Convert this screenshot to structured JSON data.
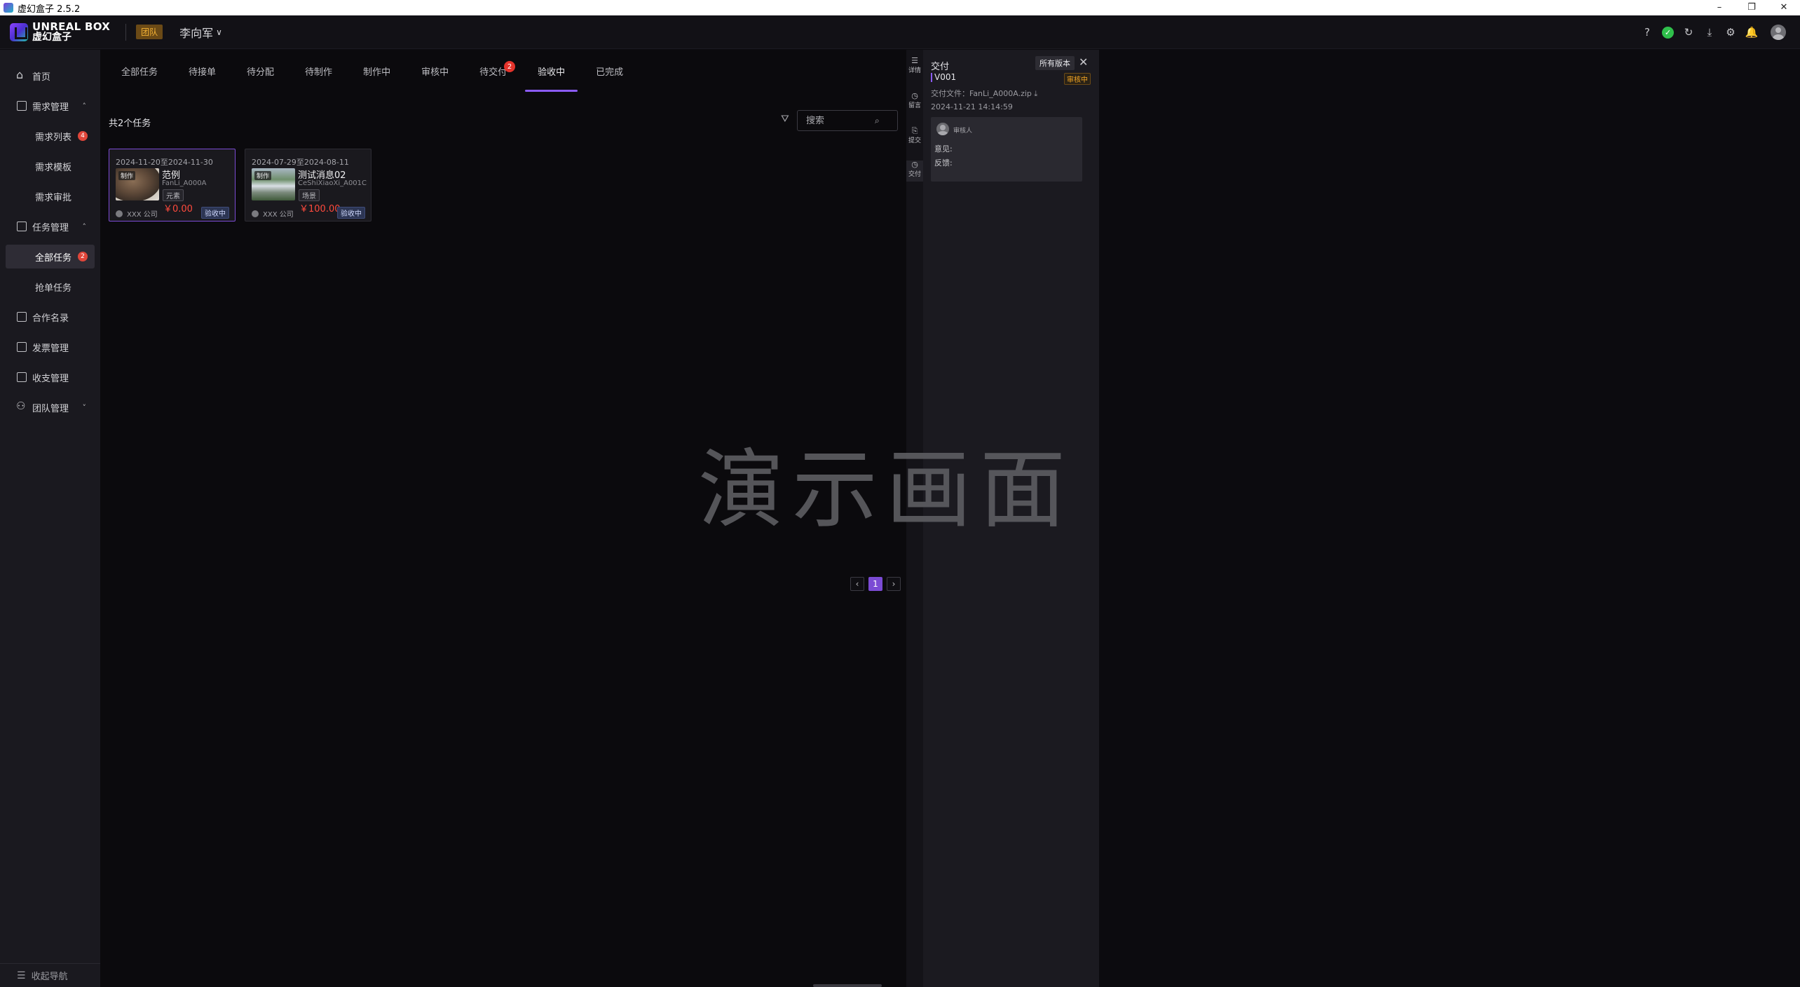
{
  "window": {
    "title": "虚幻盒子 2.5.2",
    "controls": [
      "–",
      "❐",
      "✕"
    ]
  },
  "header": {
    "logo_en": "UNREAL BOX",
    "logo_cn": "虚幻盒子",
    "team_badge": "团队",
    "user_name": "李向军",
    "user_chevron": "∨",
    "icons": [
      "help-icon",
      "status-ok-icon",
      "refresh-icon",
      "download-icon",
      "settings-icon",
      "bell-icon",
      "avatar"
    ],
    "icon_glyphs": {
      "help": "?",
      "ok": "✓",
      "refresh": "↻",
      "download": "⤓",
      "settings": "⚙",
      "bell": "🔔"
    }
  },
  "sidebar": {
    "items": [
      {
        "label": "首页"
      },
      {
        "label": "需求管理",
        "arrow": "˄"
      },
      {
        "label": "需求列表",
        "badge": "4"
      },
      {
        "label": "需求模板"
      },
      {
        "label": "需求审批"
      },
      {
        "label": "任务管理",
        "arrow": "˄"
      },
      {
        "label": "全部任务",
        "badge": "2"
      },
      {
        "label": "抢单任务"
      },
      {
        "label": "合作名录"
      },
      {
        "label": "发票管理"
      },
      {
        "label": "收支管理"
      },
      {
        "label": "团队管理",
        "arrow": "˅"
      }
    ],
    "collapse_label": "收起导航",
    "collapse_glyph": "☰"
  },
  "tabs": [
    {
      "label": "全部任务"
    },
    {
      "label": "待接单"
    },
    {
      "label": "待分配"
    },
    {
      "label": "待制作"
    },
    {
      "label": "制作中"
    },
    {
      "label": "审核中"
    },
    {
      "label": "待交付",
      "badge": "2"
    },
    {
      "label": "验收中",
      "active": true
    },
    {
      "label": "已完成"
    }
  ],
  "list": {
    "count_label": "共2个任务",
    "filter_glyph": "⛛",
    "search_placeholder": "搜索",
    "search_glyph": "⌕"
  },
  "cards": [
    {
      "date": "2024-11-20至2024-11-30",
      "tag": "制作",
      "title": "范例",
      "code": "FanLi_A000A",
      "category": "元素",
      "price": "￥0.00",
      "company": "XXX 公司",
      "status": "验收中"
    },
    {
      "date": "2024-07-29至2024-08-11",
      "tag": "制作",
      "title": "测试消息02",
      "code": "CeShiXiaoXi_A001C",
      "category": "场景",
      "price": "￥100.00",
      "company": "XXX 公司",
      "status": "验收中"
    }
  ],
  "watermark": "演示画面",
  "pagination": {
    "prev": "‹",
    "current": "1",
    "next": "›"
  },
  "rail": [
    {
      "glyph": "☰",
      "label": "详情"
    },
    {
      "glyph": "◷",
      "label": "留言"
    },
    {
      "glyph": "⎘",
      "label": "提交"
    },
    {
      "glyph": "◷",
      "label": "交付"
    }
  ],
  "panel": {
    "title": "交付",
    "all_versions": "所有版本",
    "close_glyph": "✕",
    "version": "V001",
    "version_status": "审核中",
    "file": "交付文件：FanLi_A000A.zip ⤓",
    "time": "2024-11-21 14:14:59",
    "reviewer": "审核人",
    "opinion": "意见:",
    "feedback": "反馈:"
  }
}
